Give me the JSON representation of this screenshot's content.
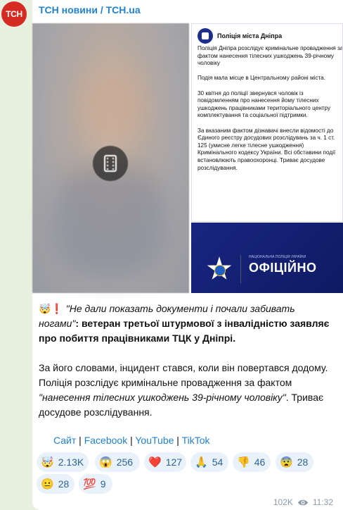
{
  "channel": {
    "avatar_text": "ТСН",
    "name": "ТСН новини / TCH.ua",
    "brand_color": "#d62b22"
  },
  "media": {
    "video_icon": "film-icon",
    "document": {
      "header": "Поліція міста Дніпра",
      "body": "Поліція Дніпра розслідує кримінальне провадження за фактом нанесення тілесних ушкоджень 39-річному чоловіку\n\nПодія мала місце в Центральному районі міста.\n\n30 квітня до поліції звернувся чоловік із повідомленням про нанесення йому тілесних ушкоджень працівниками територіального центру комплектування та соціальної підтримки.\n\nЗа вказаним фактом дізнавачі внесли відомості до Єдиного реєстру досудових розслідувань за ч. 1 ст. 125 (умисне легке тілесне ушкодження) Кримінального кодексу України. Всі обставини події встановлюють правоохоронці. Триває досудове розслідування."
    },
    "official": {
      "small_text": "НАЦІОНАЛЬНА ПОЛІЦІЯ УКРАЇНИ",
      "big_text": "ОФІЦІЙНО"
    }
  },
  "post": {
    "lead_emoji": "🤯❗",
    "quote": "\"Не дали показать документи і почали забивать ногами\"",
    "headline_rest": ": ветеран третьої штурмової з інвалідністю заявляє про побиття працівниками ТЦК у Дніпрі.",
    "para2_start": "За його словами, інцидент стався, коли він повертався додому. Поліція розслідує кримінальне провадження за фактом ",
    "para2_quote": "\"нанесення тілесних ушкоджень 39-річному чоловіку\"",
    "para2_end": ". Триває досудове розслідування."
  },
  "links": {
    "site": "Сайт",
    "facebook": "Facebook",
    "youtube": "YouTube",
    "tiktok": "TikTok",
    "separator": " | "
  },
  "reactions": [
    {
      "emoji": "🤯",
      "count": "2.13K"
    },
    {
      "emoji": "😱",
      "count": "256"
    },
    {
      "emoji": "❤️",
      "count": "127"
    },
    {
      "emoji": "🙏",
      "count": "54"
    },
    {
      "emoji": "👎",
      "count": "46"
    },
    {
      "emoji": "😨",
      "count": "28"
    },
    {
      "emoji": "😐",
      "count": "28"
    },
    {
      "emoji": "💯",
      "count": "9"
    }
  ],
  "footer": {
    "views": "102K",
    "views_icon": "eye-icon",
    "time": "11:32"
  },
  "colors": {
    "link": "#2481cc",
    "reaction_bg": "#e9f2fb",
    "chat_bg": "#e8f0e0"
  }
}
